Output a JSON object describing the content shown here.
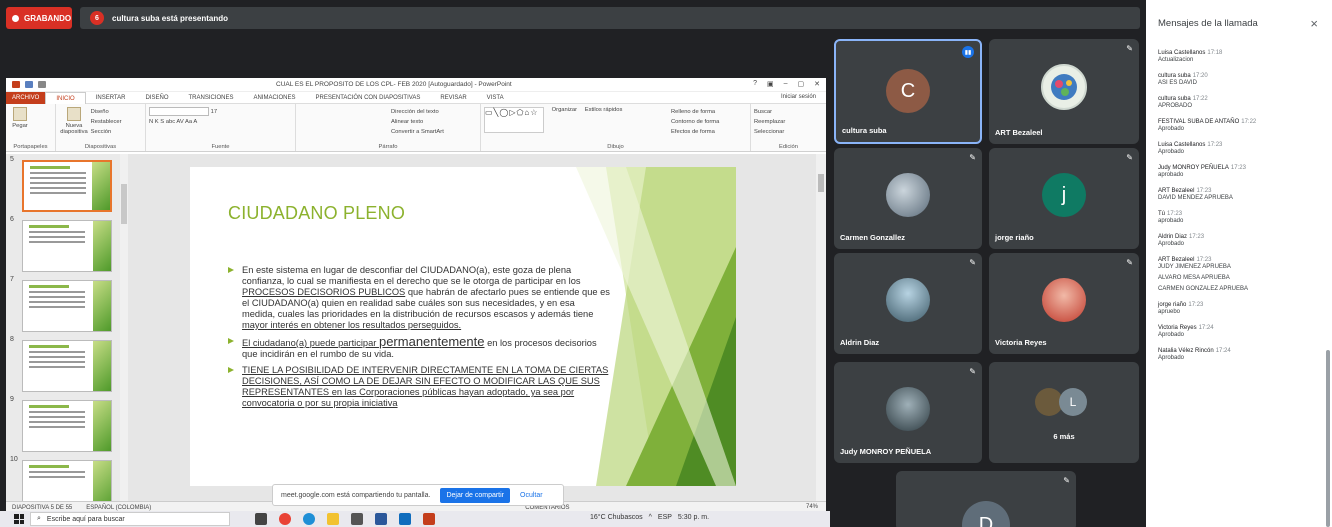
{
  "meet": {
    "recording_label": "GRABANDO",
    "presenter_count": "6",
    "presenting_text": "cultura suba está presentando"
  },
  "ppt": {
    "doc_title": "CUAL ES EL PROPOSITO DE LOS CPL- FEB 2020 [Autoguardado] - PowerPoint",
    "win_controls": [
      "?",
      "▣",
      "–",
      "▢",
      "✕"
    ],
    "tabs": [
      "ARCHIVO",
      "INICIO",
      "INSERTAR",
      "DISEÑO",
      "TRANSICIONES",
      "ANIMACIONES",
      "PRESENTACIÓN CON DIAPOSITIVAS",
      "REVISAR",
      "VISTA"
    ],
    "signin": "Iniciar sesión",
    "ribbon": {
      "paste": "Pegar",
      "new_slide": "Nueva diapositiva",
      "design": "Diseño",
      "reset": "Restablecer",
      "section": "Sección",
      "font_size": "17",
      "font_row": "N K S abc AV Aa A",
      "text_direction": "Dirección del texto",
      "align_text": "Alinear texto",
      "smartart": "Convertir a SmartArt",
      "organize": "Organizar",
      "styles": "Estilos rápidos",
      "fill": "Relleno de forma",
      "outline": "Contorno de forma",
      "effects": "Efectos de forma",
      "find": "Buscar",
      "replace": "Reemplazar",
      "select": "Seleccionar",
      "groups": [
        "Portapapeles",
        "Diapositivas",
        "Fuente",
        "Párrafo",
        "Dibujo",
        "Edición"
      ]
    },
    "thumbnails": [
      "5",
      "6",
      "7",
      "8",
      "9",
      "10"
    ],
    "slide": {
      "title": "CIUDADANO PLENO",
      "b1_p1": "En este sistema en lugar de desconfiar del CIUDADANO(a), este goza de plena confianza, lo cual se manifiesta en el derecho que se le otorga de participar en los ",
      "b1_u1": "PROCESOS DECISORIOS PUBLICOS",
      "b1_p2": " que habrán de afectarlo pues se  entiende que es el  CIUDADANO(a)  quien en realidad sabe cuáles son sus necesidades, y en esa medida, cuales las prioridades en la distribución de recursos escasos y además tiene ",
      "b1_u2": "mayor interés en obtener los resultados perseguidos.",
      "b2_u1": "El ciudadano(a) puede participar ",
      "b2_big": "permanentemente",
      "b2_p1": " en los procesos decisorios que incidirán en el rumbo de su vida.",
      "b3_u1": "TIENE  LA POSIBILIDAD  DE INTERVENIR DIRECTAMENTE  EN LA TOMA DE CIERTAS DECISIONES, ASÍ COMO LA DE DEJAR SIN EFECTO O MODIFICAR LAS QUE SUS REPRESENTANTES en las Corporaciones públicas hayan adoptado, ya sea por convocatoria o por su propia iniciativa"
    },
    "status_slide": "DIAPOSITIVA 5 DE 55",
    "status_lang": "ESPAÑOL (COLOMBIA)",
    "status_comments": "COMENTARIOS",
    "status_zoom": "74%"
  },
  "sharebar": {
    "text": "meet.google.com está compartiendo tu pantalla.",
    "stop": "Dejar de compartir",
    "hide": "Ocultar"
  },
  "taskbar": {
    "search_placeholder": "Escribe aquí para buscar",
    "weather": "16°C  Chubascos",
    "lang": "ESP",
    "time": "5:30 p. m."
  },
  "tiles": {
    "t1_initial": "C",
    "t1_name": "cultura suba",
    "t2_name": "ART Bezaleel",
    "t3_name": "Carmen Gonzallez",
    "t4_initial": "j",
    "t4_name": "jorge riaño",
    "t5_name": "Aldrin Diaz",
    "t6_name": "Victoria Reyes",
    "t7_name": "Judy MONROY PEÑUELA",
    "t8_initial": "L",
    "t8_more": "6 más",
    "t9_initial": "D"
  },
  "chat": {
    "title": "Mensajes de la llamada",
    "close": "×",
    "messages": [
      {
        "who": "Luisa Castellanos",
        "time": "17:18",
        "lines": [
          "Actualizacion"
        ]
      },
      {
        "who": "cultura suba",
        "time": "17:20",
        "lines": [
          "ASI ES DAVID"
        ]
      },
      {
        "who": "cultura suba",
        "time": "17:22",
        "lines": [
          "APROBADO"
        ]
      },
      {
        "who": "FESTIVAL SUBA DE ANTAÑO",
        "time": "17:22",
        "lines": [
          "Aprobado"
        ]
      },
      {
        "who": "Luisa Castellanos",
        "time": "17:23",
        "lines": [
          "Aprobado"
        ]
      },
      {
        "who": "Judy MONROY PEÑUELA",
        "time": "17:23",
        "lines": [
          "aprobado"
        ]
      },
      {
        "who": "ART Bezaleel",
        "time": "17:23",
        "lines": [
          "DAVID MENDEZ APRUEBA"
        ]
      },
      {
        "who": "Tú",
        "time": "17:23",
        "lines": [
          "aprobado"
        ]
      },
      {
        "who": "Aldrin Diaz",
        "time": "17:23",
        "lines": [
          "Aprobado"
        ]
      },
      {
        "who": "ART Bezaleel",
        "time": "17:23",
        "lines": [
          "JUDY JIMENEZ APRUEBA",
          "ALVARO MESA APRUEBA",
          "CARMEN GONZALEZ APRUEBA"
        ]
      },
      {
        "who": "jorge riaño",
        "time": "17:23",
        "lines": [
          "apruebo"
        ]
      },
      {
        "who": "Victoria Reyes",
        "time": "17:24",
        "lines": [
          "Aprobado"
        ]
      },
      {
        "who": "Natalia Vélez Rincón",
        "time": "17:24",
        "lines": [
          "Aprobado"
        ]
      }
    ]
  }
}
